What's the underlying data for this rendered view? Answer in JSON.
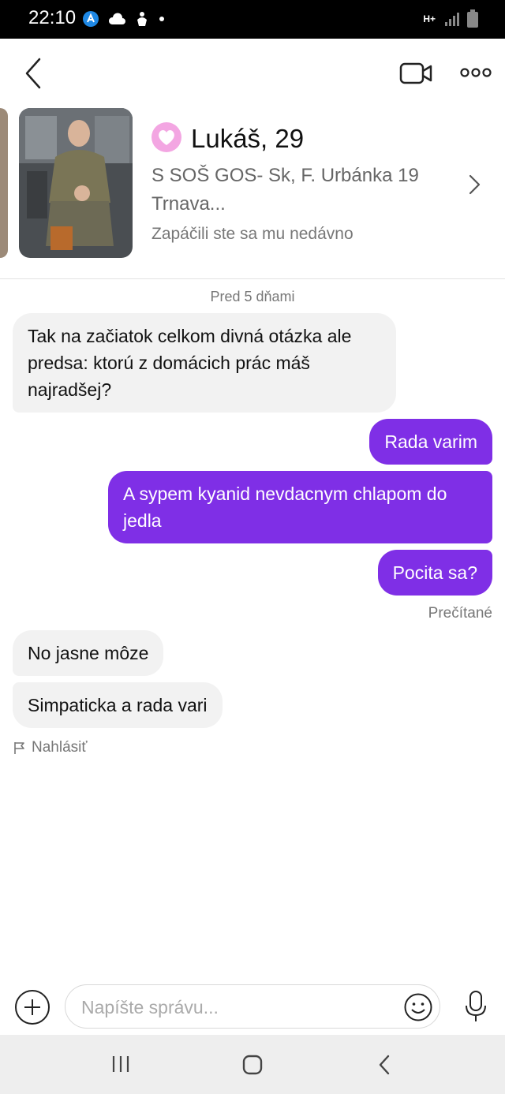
{
  "status_bar": {
    "time": "22:10",
    "network_label": "H+"
  },
  "header": {
    "back_icon": "chevron-left-icon",
    "video_icon": "video-camera-icon",
    "more_icon": "more-dots-icon"
  },
  "profile": {
    "name": "Lukáš, 29",
    "school": "S SOŠ GOS- Sk, F. Urbánka 19 Trnava...",
    "liked_text": "Zapáčili ste sa mu nedávno",
    "heart_color": "#f3a6e2"
  },
  "chat": {
    "date_label": "Pred 5 dňami",
    "messages": [
      {
        "from": "them",
        "text": "Tak na začiatok celkom divná otázka ale predsa: ktorú z domácich prác máš najradšej?"
      },
      {
        "from": "me",
        "text": "Rada varim"
      },
      {
        "from": "me",
        "text": "A sypem kyanid nevdacnym chlapom do jedla"
      },
      {
        "from": "me",
        "text": "Pocita sa?"
      },
      {
        "from": "them",
        "text": "No jasne môze"
      },
      {
        "from": "them",
        "text": "Simpaticka a rada vari"
      }
    ],
    "read_status": "Prečítané",
    "report_label": "Nahlásiť"
  },
  "compose": {
    "placeholder": "Napíšte správu..."
  },
  "colors": {
    "accent": "#7f2fe6",
    "incoming_bubble": "#f2f2f2"
  }
}
